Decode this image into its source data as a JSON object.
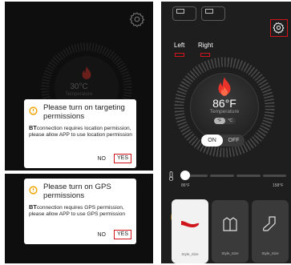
{
  "left_screen": {
    "background_gauge": {
      "temperature": "30°C",
      "label": "Temperature"
    },
    "dialogs": [
      {
        "title": "Please turn on targeting permissions",
        "body_bold": "BT",
        "body": "connection requires location permission, please allow APP to use location permission",
        "no_label": "NO",
        "yes_label": "YES"
      },
      {
        "title": "Please turn on GPS permissions",
        "body_bold": "BT",
        "body": "connection requires GPS permission, please allow APP to use GPS permission",
        "no_label": "NO",
        "yes_label": "YES"
      }
    ],
    "icons": [
      "gear-icon",
      "flame-icon",
      "location-icon"
    ]
  },
  "right_screen": {
    "sides": {
      "left": "Left",
      "right": "Right"
    },
    "temperature": {
      "value": "86°F",
      "label": "Temperature"
    },
    "unit_toggle": {
      "f": "°F",
      "c": "°C",
      "selected": "°F"
    },
    "power": {
      "on": "ON",
      "off": "OFF",
      "selected": "ON"
    },
    "slider": {
      "min_label": "86°F",
      "max_label": "158°F"
    },
    "styles": [
      {
        "name": "Style_Size",
        "icon": "sock-icon"
      },
      {
        "name": "Style_Size",
        "icon": "vest-icon"
      },
      {
        "name": "Style_Size",
        "icon": "boot-icon"
      }
    ],
    "colors": {
      "accent": "#d0141b",
      "flame": "#e8322a",
      "dark_bg": "#1e1e1e"
    }
  }
}
